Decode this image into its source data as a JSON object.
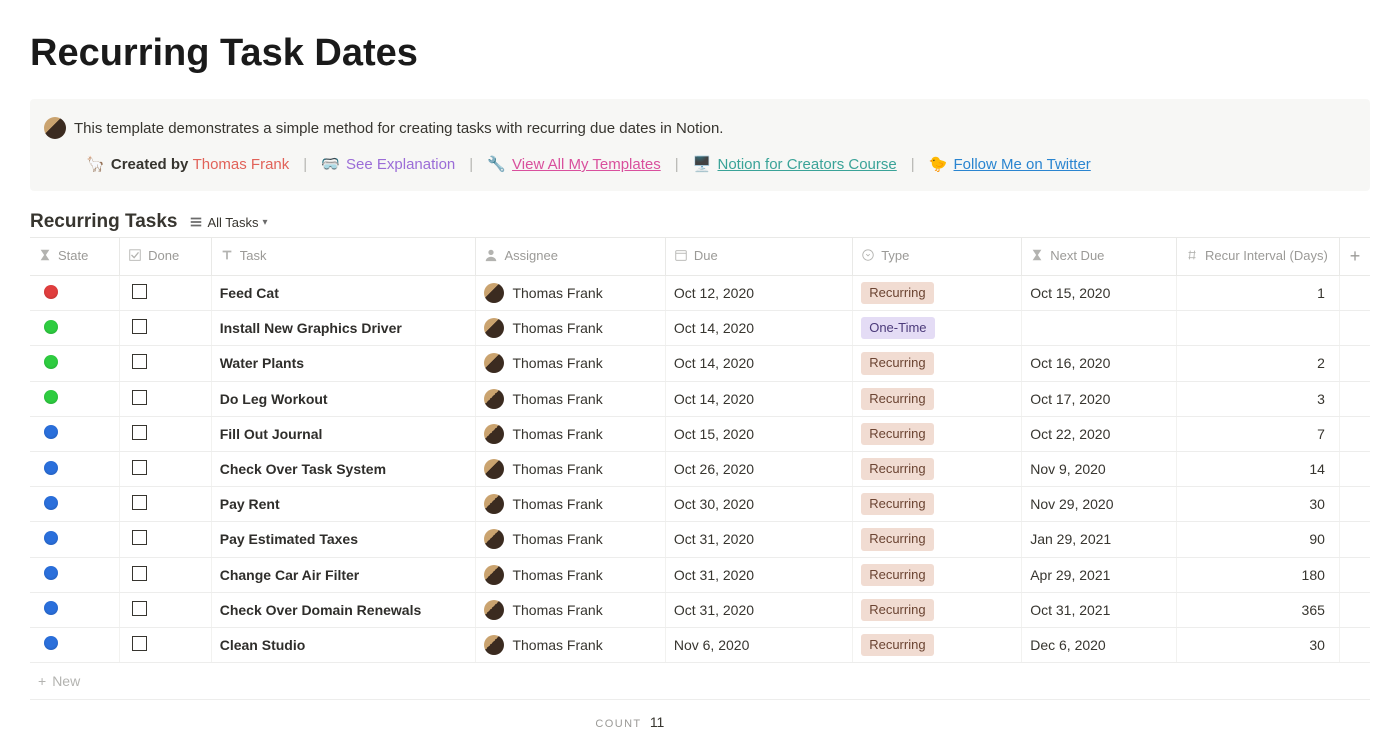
{
  "page": {
    "title": "Recurring Task Dates"
  },
  "callout": {
    "description": "This template demonstrates a simple method for creating tasks with recurring due dates in Notion.",
    "created_by_label": "Created by",
    "author": "Thomas Frank",
    "links": {
      "explanation": "See Explanation",
      "templates": "View All My Templates",
      "course": "Notion for Creators Course",
      "twitter": "Follow Me on Twitter"
    }
  },
  "view": {
    "db_title": "Recurring Tasks",
    "view_name": "All Tasks"
  },
  "columns": {
    "state": "State",
    "done": "Done",
    "task": "Task",
    "assignee": "Assignee",
    "due": "Due",
    "type": "Type",
    "next_due": "Next Due",
    "recur": "Recur Interval (Days)"
  },
  "assignee_name": "Thomas Frank",
  "type_labels": {
    "recurring": "Recurring",
    "onetime": "One-Time"
  },
  "state_colors": {
    "red": "#e03e3e",
    "green": "#2ecc40",
    "blue": "#2a6fdb"
  },
  "rows": [
    {
      "state": "red",
      "task": "Feed Cat",
      "due": "Oct 12, 2020",
      "type": "recurring",
      "next": "Oct 15, 2020",
      "interval": "1"
    },
    {
      "state": "green",
      "task": "Install New Graphics Driver",
      "due": "Oct 14, 2020",
      "type": "onetime",
      "next": "",
      "interval": ""
    },
    {
      "state": "green",
      "task": "Water Plants",
      "due": "Oct 14, 2020",
      "type": "recurring",
      "next": "Oct 16, 2020",
      "interval": "2"
    },
    {
      "state": "green",
      "task": "Do Leg Workout",
      "due": "Oct 14, 2020",
      "type": "recurring",
      "next": "Oct 17, 2020",
      "interval": "3"
    },
    {
      "state": "blue",
      "task": "Fill Out Journal",
      "due": "Oct 15, 2020",
      "type": "recurring",
      "next": "Oct 22, 2020",
      "interval": "7"
    },
    {
      "state": "blue",
      "task": "Check Over Task System",
      "due": "Oct 26, 2020",
      "type": "recurring",
      "next": "Nov 9, 2020",
      "interval": "14"
    },
    {
      "state": "blue",
      "task": "Pay Rent",
      "due": "Oct 30, 2020",
      "type": "recurring",
      "next": "Nov 29, 2020",
      "interval": "30"
    },
    {
      "state": "blue",
      "task": "Pay Estimated Taxes",
      "due": "Oct 31, 2020",
      "type": "recurring",
      "next": "Jan 29, 2021",
      "interval": "90"
    },
    {
      "state": "blue",
      "task": "Change Car Air Filter",
      "due": "Oct 31, 2020",
      "type": "recurring",
      "next": "Apr 29, 2021",
      "interval": "180"
    },
    {
      "state": "blue",
      "task": "Check Over Domain Renewals",
      "due": "Oct 31, 2020",
      "type": "recurring",
      "next": "Oct 31, 2021",
      "interval": "365"
    },
    {
      "state": "blue",
      "task": "Clean Studio",
      "due": "Nov 6, 2020",
      "type": "recurring",
      "next": "Dec 6, 2020",
      "interval": "30"
    }
  ],
  "footer": {
    "new_label": "New",
    "count_label": "Count",
    "count_value": "11"
  }
}
